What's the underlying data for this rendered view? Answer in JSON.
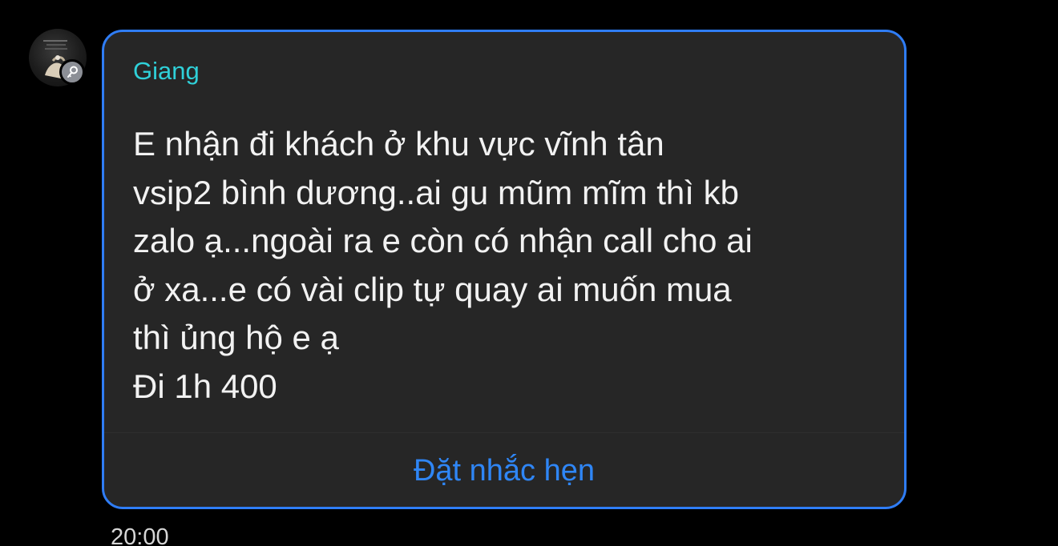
{
  "sender": {
    "name": "Giang",
    "name_color": "#2fd0d8"
  },
  "avatar": {
    "icon": "user-avatar",
    "badge_icon": "key-icon"
  },
  "message": {
    "lines": [
      "E  nhận đi khách ở khu vực vĩnh tân",
      "vsip2 bình dương..ai gu mũm mĩm thì kb",
      "zalo ạ...ngoài ra e còn có nhận call cho ai",
      "ở xa...e có vài clip tự quay ai muốn mua",
      "thì ủng hộ e ạ",
      "Đi 1h 400"
    ]
  },
  "actions": {
    "reminder_label": "Đặt nhắc hẹn"
  },
  "meta": {
    "time": "20:00"
  },
  "colors": {
    "background": "#000000",
    "bubble": "#262626",
    "bubble_border": "#2f7df6",
    "accent": "#2f86f6"
  }
}
